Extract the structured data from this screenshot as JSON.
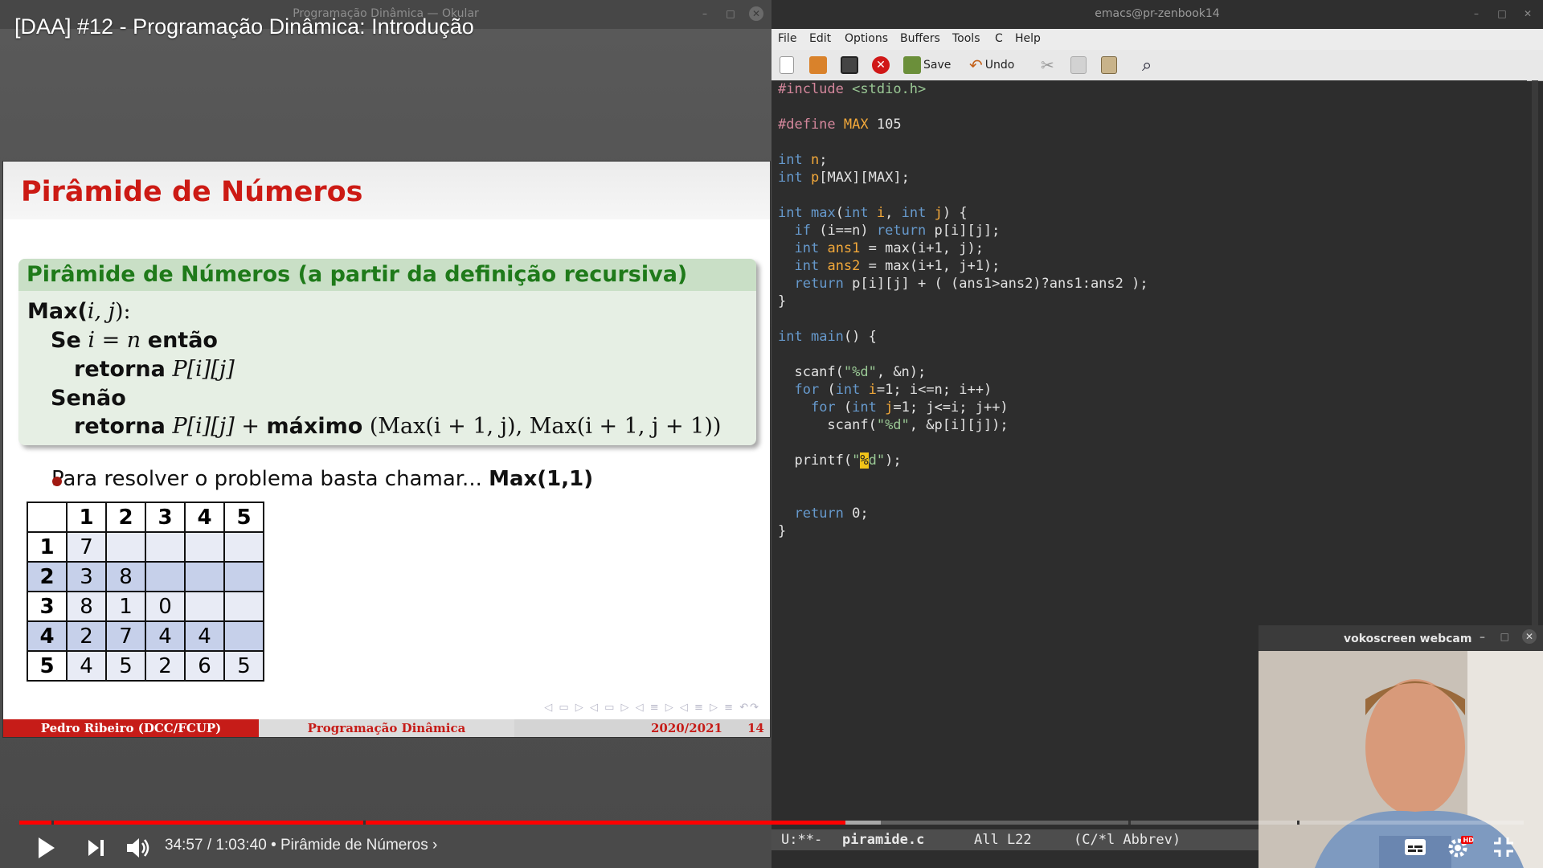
{
  "video": {
    "title": "[DAA] #12 - Programação Dinâmica: Introdução",
    "time_current": "34:57",
    "time_total": "1:03:40",
    "time_sep": " / ",
    "chapter": "• Pirâmide de Números",
    "chapter_chevron": "›",
    "progress_fraction": 0.549
  },
  "okular": {
    "window_title": "Programação Dinâmica  — Okular",
    "slide": {
      "title": "Pirâmide de Números",
      "block_title": "Pirâmide de Números (a partir da definição recursiva)",
      "def_line1_bold": "Max(",
      "def_line1_args": "i, j",
      "def_line1_end": "):",
      "def_line2_se": "Se",
      "def_line2_cond": "i = n",
      "def_line2_entao": "então",
      "def_line3_ret": "retorna",
      "def_line3_expr": "P[i][j]",
      "def_line4": "Senão",
      "def_line5_ret": "retorna",
      "def_line5_expr": "P[i][j] +",
      "def_line5_max": "máximo",
      "def_line5_args": "(Max(i + 1, j), Max(i + 1, j + 1))",
      "bullet_text": "Para resolver o problema basta chamar...",
      "bullet_bold": "Max(1,1)",
      "table_header": [
        "",
        "1",
        "2",
        "3",
        "4",
        "5"
      ],
      "table_rows": [
        [
          "1",
          "7",
          "",
          "",
          "",
          ""
        ],
        [
          "2",
          "3",
          "8",
          "",
          "",
          ""
        ],
        [
          "3",
          "8",
          "1",
          "0",
          "",
          ""
        ],
        [
          "4",
          "2",
          "7",
          "4",
          "4",
          ""
        ],
        [
          "5",
          "4",
          "5",
          "2",
          "6",
          "5"
        ]
      ],
      "footer_author": "Pedro Ribeiro  (DCC/FCUP)",
      "footer_topic": "Programação Dinâmica",
      "footer_year": "2020/2021",
      "footer_page": "14"
    }
  },
  "emacs": {
    "window_title": "emacs@pr-zenbook14",
    "menu": [
      "File",
      "Edit",
      "Options",
      "Buffers",
      "Tools",
      "C",
      "Help"
    ],
    "toolbar": {
      "save_label": "Save",
      "undo_label": "Undo"
    },
    "modeline": {
      "status": "U:**-",
      "buffer": "piramide.c",
      "position": "All L22",
      "mode": "(C/*l Abbrev)"
    }
  },
  "webcam": {
    "title": "vokoscreen webcam"
  },
  "colors": {
    "accent_red": "#cc1a14",
    "progress_red": "#ff0000",
    "block_green": "#1f7a1a"
  }
}
